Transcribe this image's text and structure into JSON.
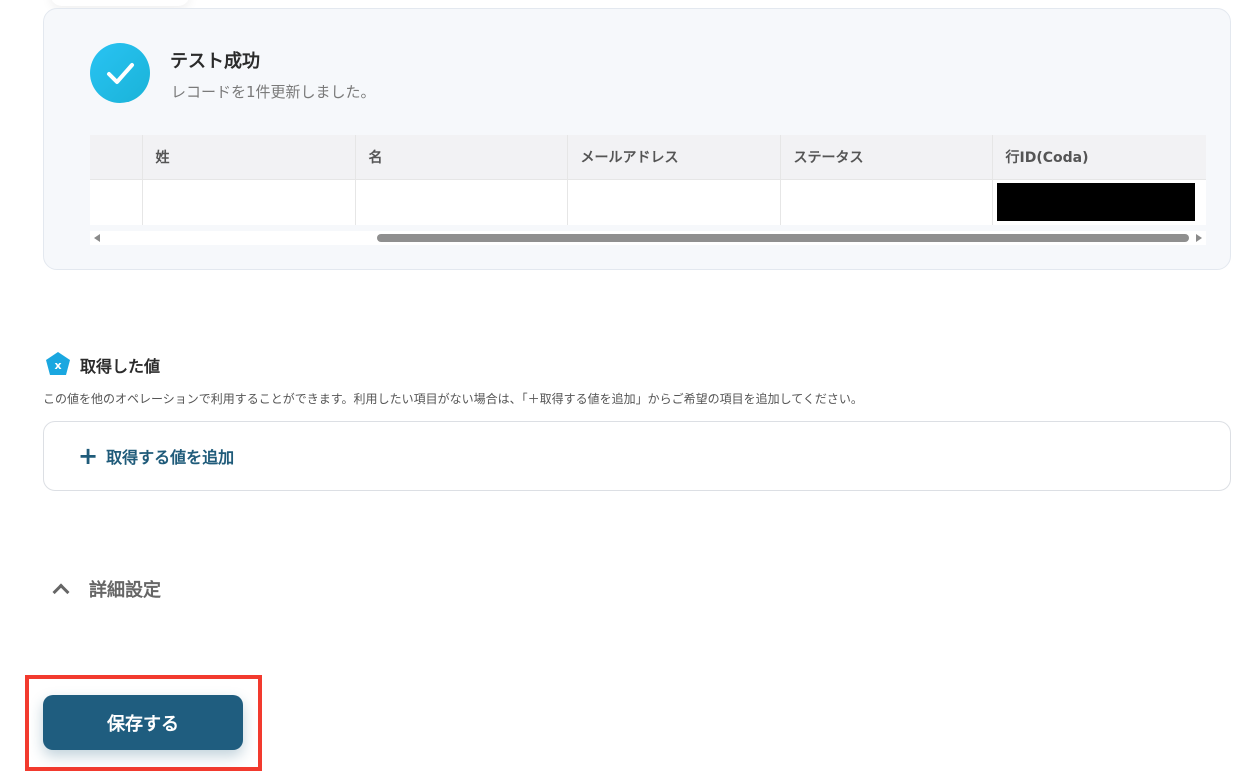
{
  "result": {
    "title": "テスト成功",
    "description": "レコードを1件更新しました。",
    "table": {
      "headers": [
        "",
        "姓",
        "名",
        "メールアドレス",
        "ステータス",
        "行ID(Coda)"
      ],
      "rows": [
        [
          "",
          "",
          "",
          "",
          "",
          ""
        ]
      ]
    }
  },
  "fetched_values": {
    "title": "取得した値",
    "description": "この値を他のオペレーションで利用することができます。利用したい項目がない場合は、「＋取得する値を追加」からご希望の項目を追加してください。",
    "add_label": "取得する値を追加"
  },
  "advanced": {
    "label": "詳細設定"
  },
  "save_button": {
    "label": "保存する"
  },
  "colors": {
    "accent": "#1f5d7f",
    "success": "#29c3f3",
    "highlight": "#f23a2e"
  }
}
